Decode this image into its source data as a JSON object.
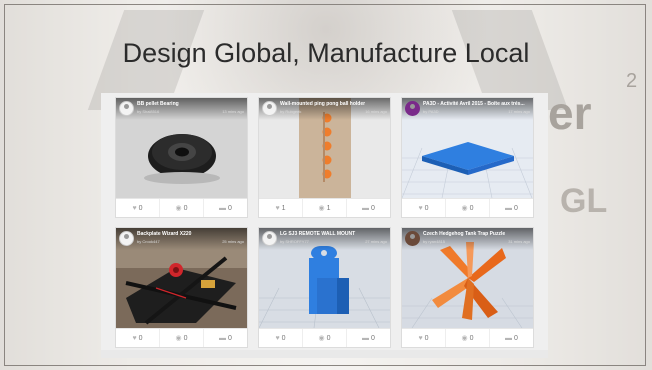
{
  "slide": {
    "title": "Design Global, Manufacture Local",
    "background_text_er": "er",
    "background_text_sup": "2",
    "background_text_gl": "GL"
  },
  "cards": [
    {
      "title": "BB pellet Bearing",
      "author": "by Shai8516",
      "ago": "13 mins ago",
      "likes": "0",
      "views": "0",
      "comments": "0"
    },
    {
      "title": "Wall-mounted ping pong ball holder",
      "author": "by Rubgeek",
      "ago": "16 mins ago",
      "likes": "1",
      "views": "1",
      "comments": "0"
    },
    {
      "title": "PA3D - Activité Avril 2015 - Boîte aux trés...",
      "author": "by PA3D",
      "ago": "17 mins ago",
      "likes": "0",
      "views": "0",
      "comments": "0"
    },
    {
      "title": "Backplate Wizard X220",
      "author": "by Crook447",
      "ago": "25 mins ago",
      "likes": "0",
      "views": "0",
      "comments": "0"
    },
    {
      "title": "LG SJ3 REMOTE WALL MOUNT",
      "author": "by SHROFFY77",
      "ago": "27 mins ago",
      "likes": "0",
      "views": "0",
      "comments": "0"
    },
    {
      "title": "Czech Hedgehog Tank Trap Puzzle",
      "author": "by ryan4815",
      "ago": "31 mins ago",
      "likes": "0",
      "views": "0",
      "comments": "0"
    }
  ],
  "colors": {
    "accent_orange": "#e8773a",
    "blue_model": "#2f7fe0",
    "orange_model": "#f07a2a"
  }
}
